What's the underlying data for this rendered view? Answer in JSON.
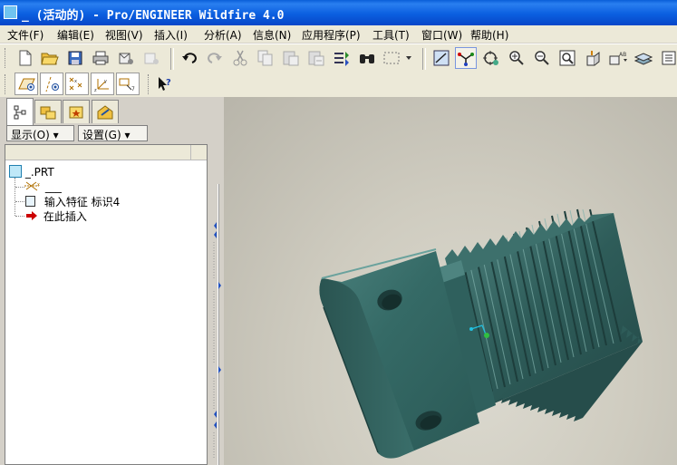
{
  "window": {
    "title": "_ (活动的) - Pro/ENGINEER Wildfire 4.0"
  },
  "menu": [
    "文件(F)",
    "编辑(E)",
    "视图(V)",
    "插入(I)",
    "分析(A)",
    "信息(N)",
    "应用程序(P)",
    "工具(T)",
    "窗口(W)",
    "帮助(H)"
  ],
  "panel": {
    "show_label": "显示(O) ▾",
    "settings_label": "设置(G) ▾"
  },
  "tree": {
    "root": "_.PRT",
    "items": [
      {
        "label": "___",
        "icon": "csys-icon"
      },
      {
        "label": "输入特征 标识4",
        "icon": "feature-icon"
      },
      {
        "label": "在此插入",
        "icon": "insert-here-arrow-icon"
      }
    ]
  },
  "colors": {
    "title_bar": "#0b5fe0",
    "model": "#2c5a57",
    "insert_arrow": "#cc0000"
  }
}
